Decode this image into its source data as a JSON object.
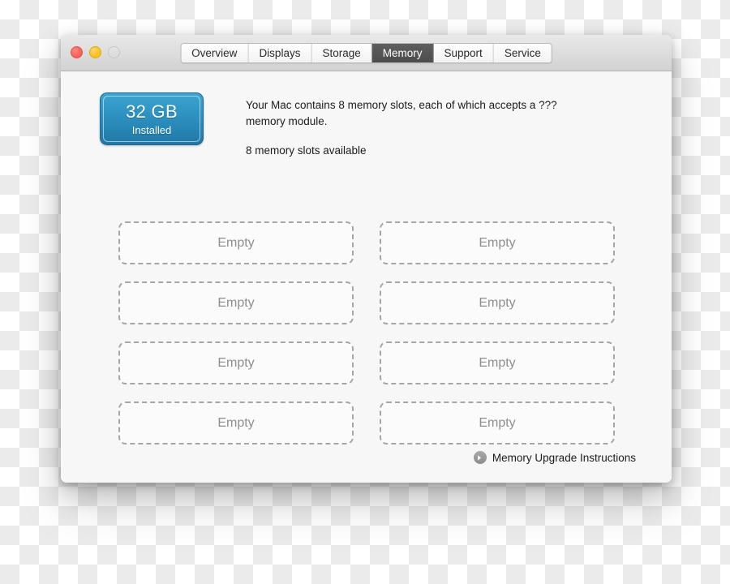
{
  "window": {
    "traffic_lights": [
      {
        "name": "close",
        "color": "#fb6b62",
        "state": "enabled"
      },
      {
        "name": "minimize",
        "color": "#fdc52f",
        "state": "enabled"
      },
      {
        "name": "zoom",
        "color": "#dedede",
        "state": "disabled"
      }
    ],
    "tabs": [
      {
        "label": "Overview",
        "selected": false
      },
      {
        "label": "Displays",
        "selected": false
      },
      {
        "label": "Storage",
        "selected": false
      },
      {
        "label": "Memory",
        "selected": true
      },
      {
        "label": "Support",
        "selected": false
      },
      {
        "label": "Service",
        "selected": false
      }
    ]
  },
  "memory": {
    "badge": {
      "size": "32 GB",
      "state": "Installed",
      "accent_color": "#2e93c2"
    },
    "description": "Your Mac contains 8 memory slots, each of which accepts a ??? memory module.",
    "available": "8 memory slots available",
    "slots": [
      {
        "label": "Empty"
      },
      {
        "label": "Empty"
      },
      {
        "label": "Empty"
      },
      {
        "label": "Empty"
      },
      {
        "label": "Empty"
      },
      {
        "label": "Empty"
      },
      {
        "label": "Empty"
      },
      {
        "label": "Empty"
      }
    ]
  },
  "footer": {
    "upgrade_icon": "arrow-right-circle-icon",
    "upgrade_label": "Memory Upgrade Instructions"
  }
}
